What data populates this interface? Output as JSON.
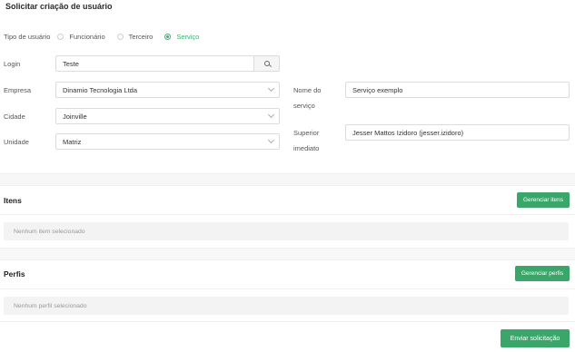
{
  "page_title": "Solicitar criação de usuário",
  "user_type": {
    "label": "Tipo de usuário",
    "options": [
      "Funcionário",
      "Terceiro",
      "Serviço"
    ],
    "selected": "Serviço"
  },
  "login": {
    "label": "Login",
    "value": "Teste"
  },
  "empresa": {
    "label": "Empresa",
    "value": "Dinamio Tecnologia Ltda"
  },
  "cidade": {
    "label": "Cidade",
    "value": "Joinville"
  },
  "unidade": {
    "label": "Unidade",
    "value": "Matriz"
  },
  "nome_servico": {
    "label_line1": "Nome do",
    "label_line2": "serviço",
    "value": "Serviço exemplo"
  },
  "superior": {
    "label_line1": "Superior",
    "label_line2": "imediato",
    "value": "Jesser Mattos Izidoro (jesser.izidoro)"
  },
  "itens": {
    "title": "Itens",
    "button": "Gerenciar itens",
    "empty": "Nenhum item selecionado"
  },
  "perfis": {
    "title": "Perfis",
    "button": "Gerenciar perfis",
    "empty": "Nenhum perfil selecionado"
  },
  "submit": "Enviar solicitação",
  "colors": {
    "accent": "#3aa66a",
    "radio_checked": "#3bb273"
  },
  "icons": {
    "search": "search-icon",
    "dropdown": "chevron-down-icon"
  }
}
